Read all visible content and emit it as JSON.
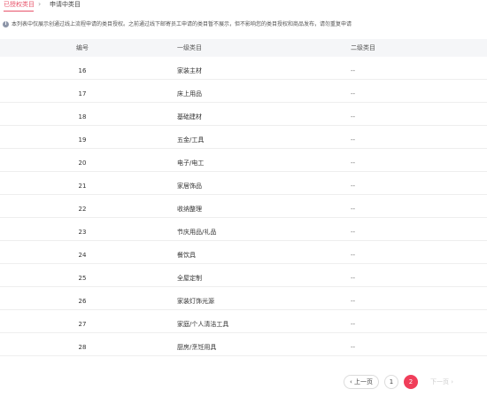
{
  "tabs": {
    "active": "已授权类目",
    "separator": "›",
    "inactive": "申请中类目"
  },
  "notice": {
    "icon": "info-icon",
    "text": "本列表中仅展示创通过线上流程申请的类目授权。之前通过线下邮寄员工申请的类目暂不展示，但不影响您的类目授权和商品发布，请勿重复申请"
  },
  "table": {
    "headers": {
      "num": "编号",
      "cat1": "一级类目",
      "cat2": "二级类目"
    },
    "rows": [
      {
        "num": "16",
        "cat1": "家装主材",
        "cat2": "--"
      },
      {
        "num": "17",
        "cat1": "床上用品",
        "cat2": "--"
      },
      {
        "num": "18",
        "cat1": "基础建材",
        "cat2": "--"
      },
      {
        "num": "19",
        "cat1": "五金/工具",
        "cat2": "--"
      },
      {
        "num": "20",
        "cat1": "电子/电工",
        "cat2": "--"
      },
      {
        "num": "21",
        "cat1": "家居饰品",
        "cat2": "--"
      },
      {
        "num": "22",
        "cat1": "收纳整理",
        "cat2": "--"
      },
      {
        "num": "23",
        "cat1": "节庆用品/礼品",
        "cat2": "--"
      },
      {
        "num": "24",
        "cat1": "餐饮具",
        "cat2": "--"
      },
      {
        "num": "25",
        "cat1": "全屋定制",
        "cat2": "--"
      },
      {
        "num": "26",
        "cat1": "家装灯饰光源",
        "cat2": "--"
      },
      {
        "num": "27",
        "cat1": "家庭/个人清洁工具",
        "cat2": "--"
      },
      {
        "num": "28",
        "cat1": "厨房/烹饪用具",
        "cat2": "--"
      }
    ]
  },
  "pagination": {
    "prev_label": "‹ 上一页",
    "pages": [
      "1",
      "2"
    ],
    "current_page": "2",
    "next_label": "下一页 ›",
    "accent_color": "#f03e5a"
  }
}
